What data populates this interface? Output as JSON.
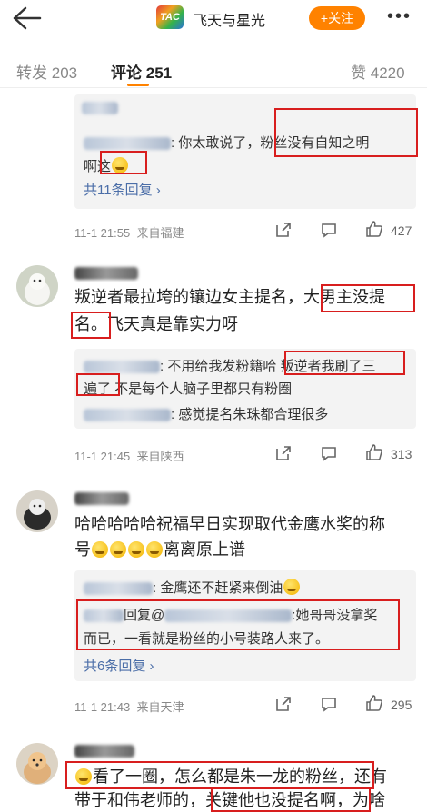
{
  "header": {
    "back_icon": "back-arrow-icon",
    "logo_text": "TAC",
    "account_name": "飞天与星光",
    "follow_label": "+关注",
    "more_icon": "more-icon",
    "colors": {
      "accent": "#ff8200",
      "link": "#4b6ea8",
      "highlight_box": "#d81e1e"
    }
  },
  "tabs": [
    {
      "label": "转发",
      "count": "203"
    },
    {
      "label": "评论",
      "count": "251"
    },
    {
      "label": "赞",
      "count": "4220"
    }
  ],
  "comments": [
    {
      "replies": [
        {
          "text": ": 你太敢说了，粉丝没有自知之明",
          "text_cont": "啊这"
        }
      ],
      "more_replies": "共11条回复 ›",
      "time": "11-1 21:55",
      "location": "来自福建",
      "likes": "427"
    },
    {
      "text_line1": "叛逆者最拉垮的镶边女主提名，大男主没提",
      "text_line2": "名。飞天真是靠实力呀",
      "replies": [
        {
          "text": ": 不用给我发粉籍哈 叛逆者我刷了三",
          "text_cont": "遍了 不是每个人脑子里都只有粉圈"
        },
        {
          "text": ": 感觉提名朱珠都合理很多"
        }
      ],
      "time": "11-1 21:45",
      "location": "来自陕西",
      "likes": "313"
    },
    {
      "text_line1": "哈哈哈哈哈祝福早日实现取代金鹰水奖的称",
      "text_line2": "号",
      "text_line2_tail": "离离原上谱",
      "replies": [
        {
          "text": ": 金鹰还不赶紧来倒油"
        },
        {
          "text_a": "回复@",
          "text_b": ":她哥哥没拿奖",
          "text_cont": "而已，一看就是粉丝的小号装路人来了。"
        }
      ],
      "more_replies": "共6条回复 ›",
      "time": "11-1 21:43",
      "location": "来自天津",
      "likes": "295"
    },
    {
      "text_line1": "看了一圈，怎么都是朱一龙的粉丝，还有",
      "text_line2": "带于和伟老师的，关键他也没提名啊，为啥"
    }
  ]
}
